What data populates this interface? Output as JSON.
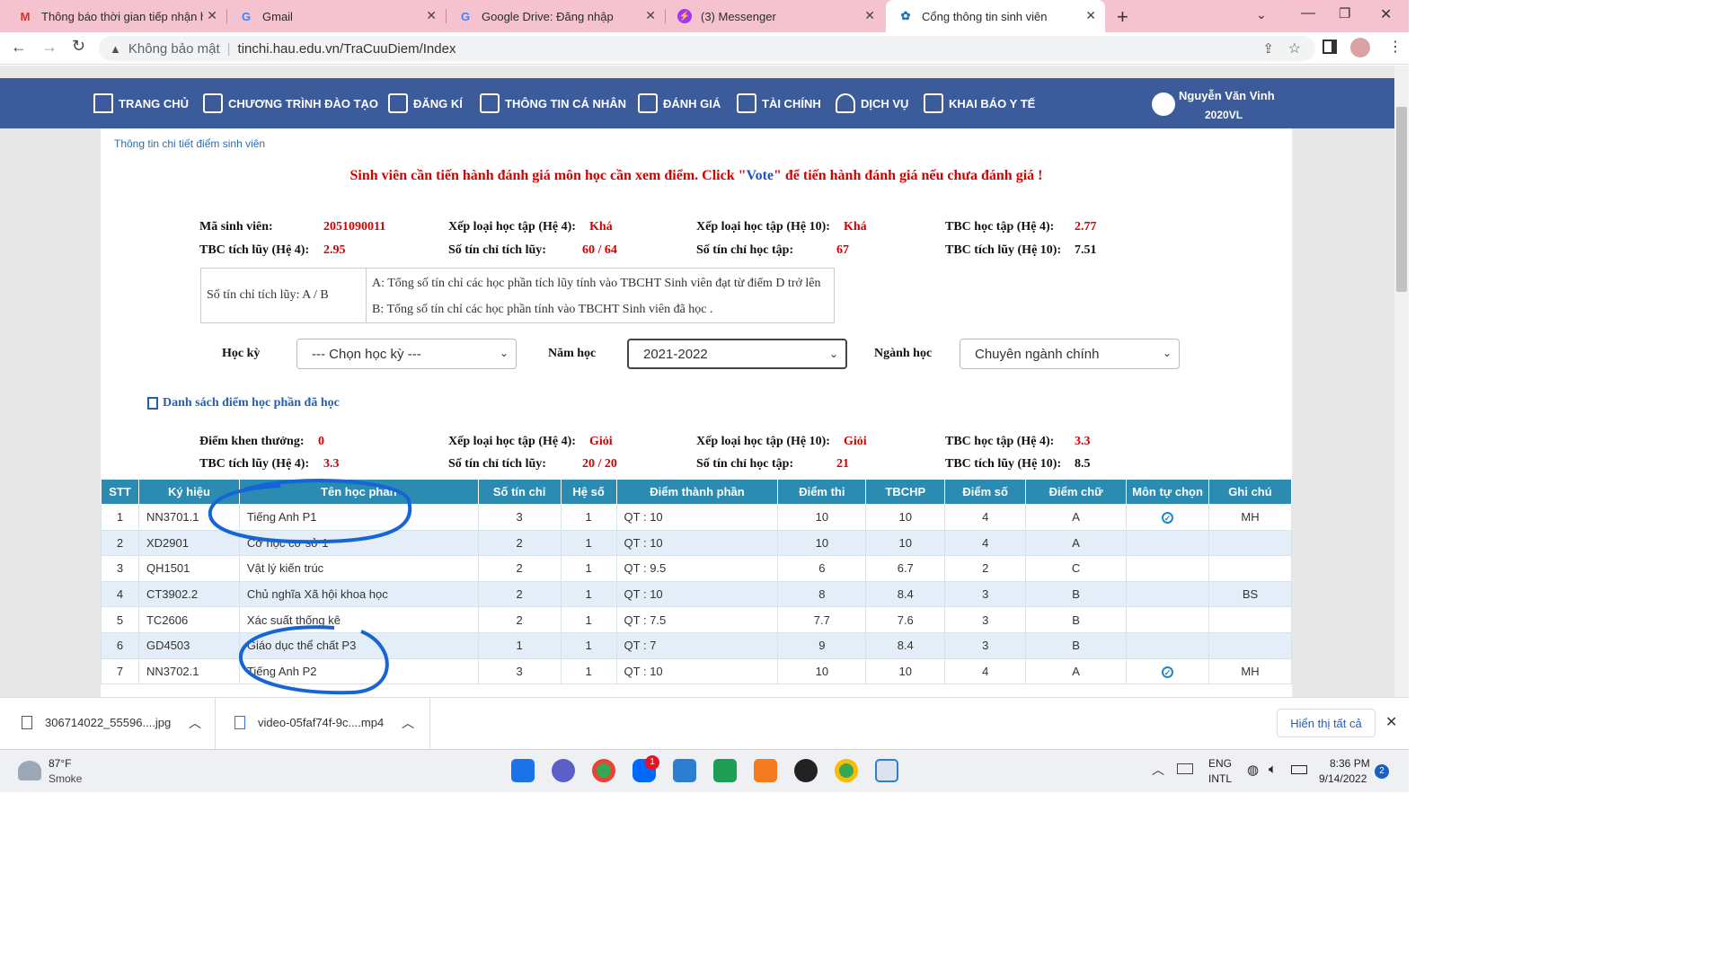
{
  "browser": {
    "tabs": [
      {
        "title": "Thông báo thời gian tiếp nhận hồ",
        "icon": "gmail-icon"
      },
      {
        "title": "Gmail",
        "icon": "google-icon"
      },
      {
        "title": "Google Drive: Đăng nhập",
        "icon": "google-icon"
      },
      {
        "title": "(3) Messenger",
        "icon": "messenger-icon"
      },
      {
        "title": "Cổng thông tin sinh viên",
        "icon": "portal-icon"
      }
    ],
    "security_label": "Không bảo mật",
    "url": "tinchi.hau.edu.vn/TraCuuDiem/Index"
  },
  "nav": {
    "items": [
      "TRANG CHỦ",
      "CHƯƠNG TRÌNH ĐÀO TẠO",
      "ĐĂNG KÍ",
      "THÔNG TIN CÁ NHÂN",
      "ĐÁNH GIÁ",
      "TÀI CHÍNH",
      "DỊCH VỤ",
      "KHAI BÁO Y TẾ"
    ],
    "user_name": "Nguyễn Văn Vinh",
    "user_class": "2020VL"
  },
  "breadcrumb": "Thông tin chi tiết điểm sinh viên",
  "notice": {
    "before": "Sinh viên cần tiến hành đánh giá môn học cần xem điểm. Click \"",
    "link": "Vote",
    "after": "\" để tiến hành đánh giá nếu chưa đánh giá !"
  },
  "summary": {
    "student_id_label": "Mã sinh viên:",
    "student_id": "2051090011",
    "rank4_label": "Xếp loại học tập (Hệ 4):",
    "rank4": "Khá",
    "rank10_label": "Xếp loại học tập (Hệ 10):",
    "rank10": "Khá",
    "gpa4_label": "TBC học tập (Hệ 4):",
    "gpa4": "2.77",
    "cum4_label": "TBC tích lũy (Hệ 4):",
    "cum4": "2.95",
    "credits_acc_label": "Số tín chỉ tích lũy:",
    "credits_acc": "60 / 64",
    "credits_study_label": "Số tín chỉ học tập:",
    "credits_study": "67",
    "cum10_label": "TBC tích lũy (Hệ 10):",
    "cum10": "7.51"
  },
  "legend_box": {
    "left": "Số tín chỉ tích lũy: A / B",
    "a": "A: Tổng số tín chỉ các học phần tích lũy tính vào TBCHT Sinh viên đạt từ điểm D trở lên",
    "b": "B: Tổng số tín chỉ các học phần tính vào TBCHT Sinh viên đã học ."
  },
  "filters": {
    "semester_label": "Học kỳ",
    "semester_value": "--- Chọn học kỳ ---",
    "year_label": "Năm học",
    "year_value": "2021-2022",
    "major_label": "Ngành học",
    "major_value": "Chuyên ngành chính"
  },
  "list_title": "Danh sách điểm học phần đã học",
  "term_summary": {
    "bonus_label": "Điểm khen thưởng:",
    "bonus": "0",
    "rank4_label": "Xếp loại học tập (Hệ 4):",
    "rank4": "Giỏi",
    "rank10_label": "Xếp loại học tập (Hệ 10):",
    "rank10": "Giỏi",
    "gpa4_label": "TBC học tập (Hệ 4):",
    "gpa4": "3.3",
    "cum4_label": "TBC tích lũy (Hệ 4):",
    "cum4": "3.3",
    "credits_acc_label": "Số tín chỉ tích lũy:",
    "credits_acc": "20 / 20",
    "credits_study_label": "Số tín chỉ học tập:",
    "credits_study": "21",
    "cum10_label": "TBC tích lũy (Hệ 10):",
    "cum10": "8.5"
  },
  "table": {
    "headers": [
      "STT",
      "Ký hiệu",
      "Tên học phần",
      "Số tín chỉ",
      "Hệ số",
      "Điểm thành phần",
      "Điểm thi",
      "TBCHP",
      "Điểm số",
      "Điểm chữ",
      "Môn tự chọn",
      "Ghi chú"
    ],
    "rows": [
      [
        "1",
        "NN3701.1",
        "Tiếng Anh P1",
        "3",
        "1",
        "QT : 10",
        "10",
        "10",
        "4",
        "A",
        "check",
        "MH"
      ],
      [
        "2",
        "XD2901",
        "Cơ học cơ sở 1",
        "2",
        "1",
        "QT : 10",
        "10",
        "10",
        "4",
        "A",
        "",
        ""
      ],
      [
        "3",
        "QH1501",
        "Vật lý kiến trúc",
        "2",
        "1",
        "QT : 9.5",
        "6",
        "6.7",
        "2",
        "C",
        "",
        ""
      ],
      [
        "4",
        "CT3902.2",
        "Chủ nghĩa Xã hội khoa học",
        "2",
        "1",
        "QT : 10",
        "8",
        "8.4",
        "3",
        "B",
        "",
        "BS"
      ],
      [
        "5",
        "TC2606",
        "Xác suất thống kê",
        "2",
        "1",
        "QT : 7.5",
        "7.7",
        "7.6",
        "3",
        "B",
        "",
        ""
      ],
      [
        "6",
        "GD4503",
        "Giáo dục thể chất P3",
        "1",
        "1",
        "QT : 7",
        "9",
        "8.4",
        "3",
        "B",
        "",
        ""
      ],
      [
        "7",
        "NN3702.1",
        "Tiếng Anh P2",
        "3",
        "1",
        "QT : 10",
        "10",
        "10",
        "4",
        "A",
        "check",
        "MH"
      ]
    ]
  },
  "downloads": {
    "items": [
      "306714022_55596....jpg",
      "video-05faf74f-9c....mp4"
    ],
    "show_all": "Hiển thị tất cả"
  },
  "taskbar": {
    "temp": "87°F",
    "weather": "Smoke",
    "lang1": "ENG",
    "lang2": "INTL",
    "time": "8:36 PM",
    "date": "9/14/2022",
    "badge": "2"
  }
}
